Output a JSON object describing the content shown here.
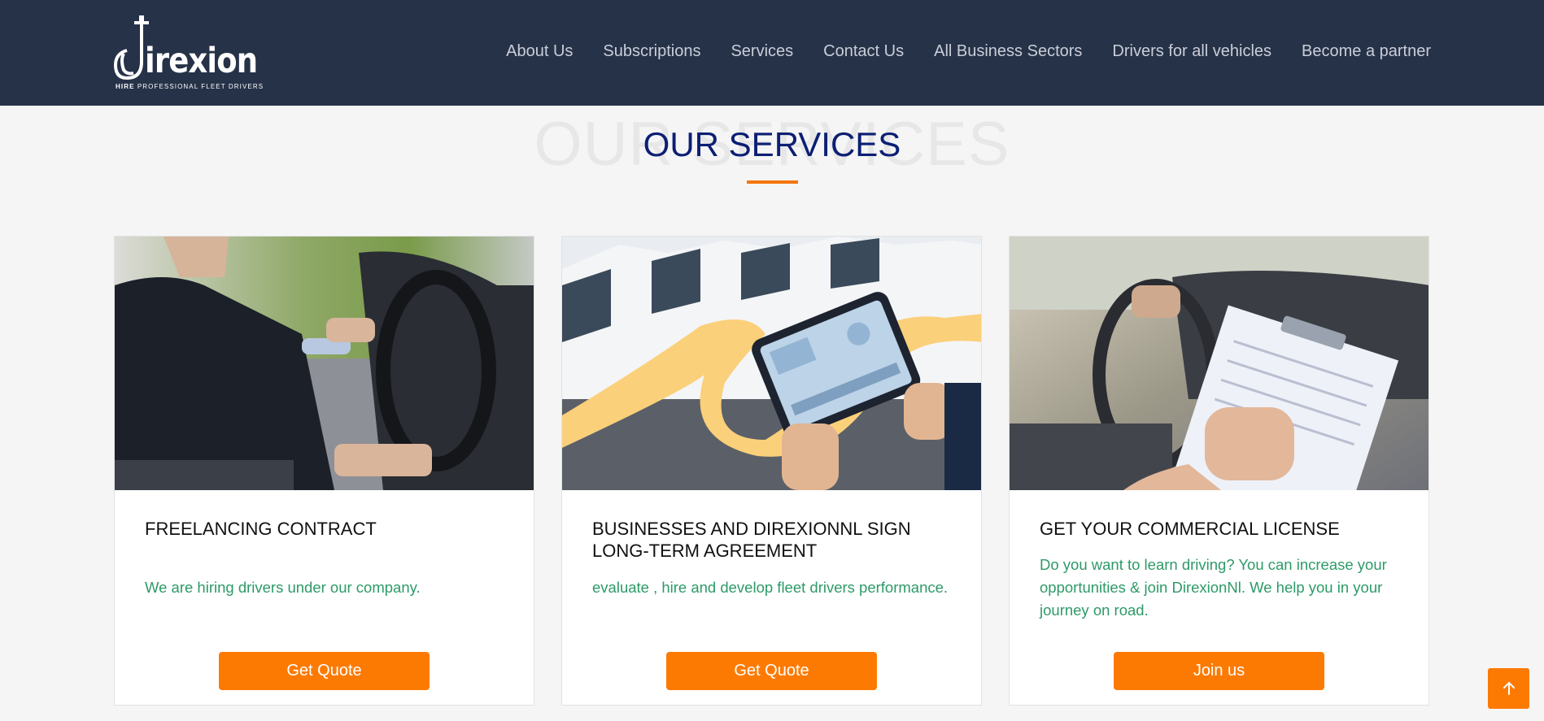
{
  "logo": {
    "name": "irexion",
    "tagline_bold": "HIRE",
    "tagline_rest": "PROFESSIONAL FLEET DRIVERS"
  },
  "nav": {
    "items": [
      "About Us",
      "Subscriptions",
      "Services",
      "Contact Us",
      "All Business Sectors",
      "Drivers for all vehicles",
      "Become a partner"
    ]
  },
  "section": {
    "bg_word": "OUR SERVICES",
    "title": "OUR SERVICES"
  },
  "cards": [
    {
      "title": "FREELANCING CONTRACT",
      "desc": "We are hiring drivers under our company.",
      "button": "Get Quote"
    },
    {
      "title": "BUSINESSES AND DIREXIONNL SIGN LONG-TERM AGREEMENT",
      "desc": "evaluate , hire and develop fleet drivers performance.",
      "button": "Get Quote"
    },
    {
      "title": "GET YOUR COMMERCIAL LICENSE",
      "desc": "Do you want to learn driving? You can increase your opportunities & join DirexionNl. We help you in your journey on road.",
      "button": "Join us"
    }
  ],
  "colors": {
    "header": "#263248",
    "accent": "#fd7a02",
    "title": "#0b1f74",
    "desc": "#2d9a67"
  },
  "icons": {
    "scroll_top": "arrow-up-icon"
  }
}
